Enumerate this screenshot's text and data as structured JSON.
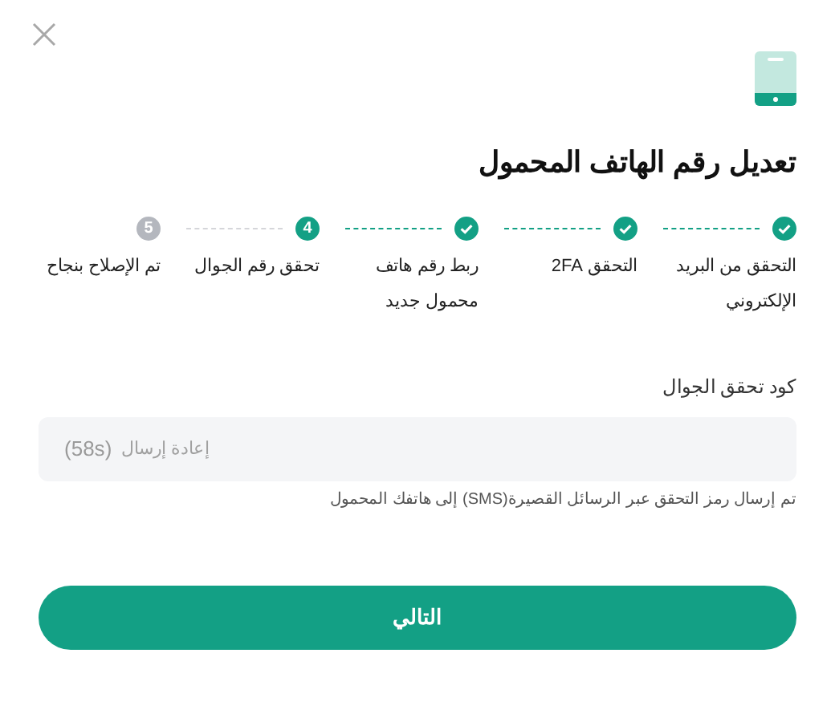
{
  "title": "تعديل رقم الهاتف المحمول",
  "steps": [
    {
      "label": "التحقق من البريد الإلكتروني",
      "done": true,
      "current": false
    },
    {
      "label": "التحقق 2FA",
      "done": true,
      "current": false
    },
    {
      "label": "ربط رقم هاتف محمول جديد",
      "done": true,
      "current": false
    },
    {
      "label": "تحقق رقم الجوال",
      "done": false,
      "current": true,
      "number": "4"
    },
    {
      "label": "تم الإصلاح بنجاح",
      "done": false,
      "current": false,
      "number": "5"
    }
  ],
  "field": {
    "label": "كود تحقق الجوال",
    "resend": "إعادة إرسال",
    "countdown": "(58s)",
    "hint": "تم إرسال رمز التحقق عبر الرسائل القصيرة(SMS) إلى هاتفك المحمول"
  },
  "button": "التالي"
}
